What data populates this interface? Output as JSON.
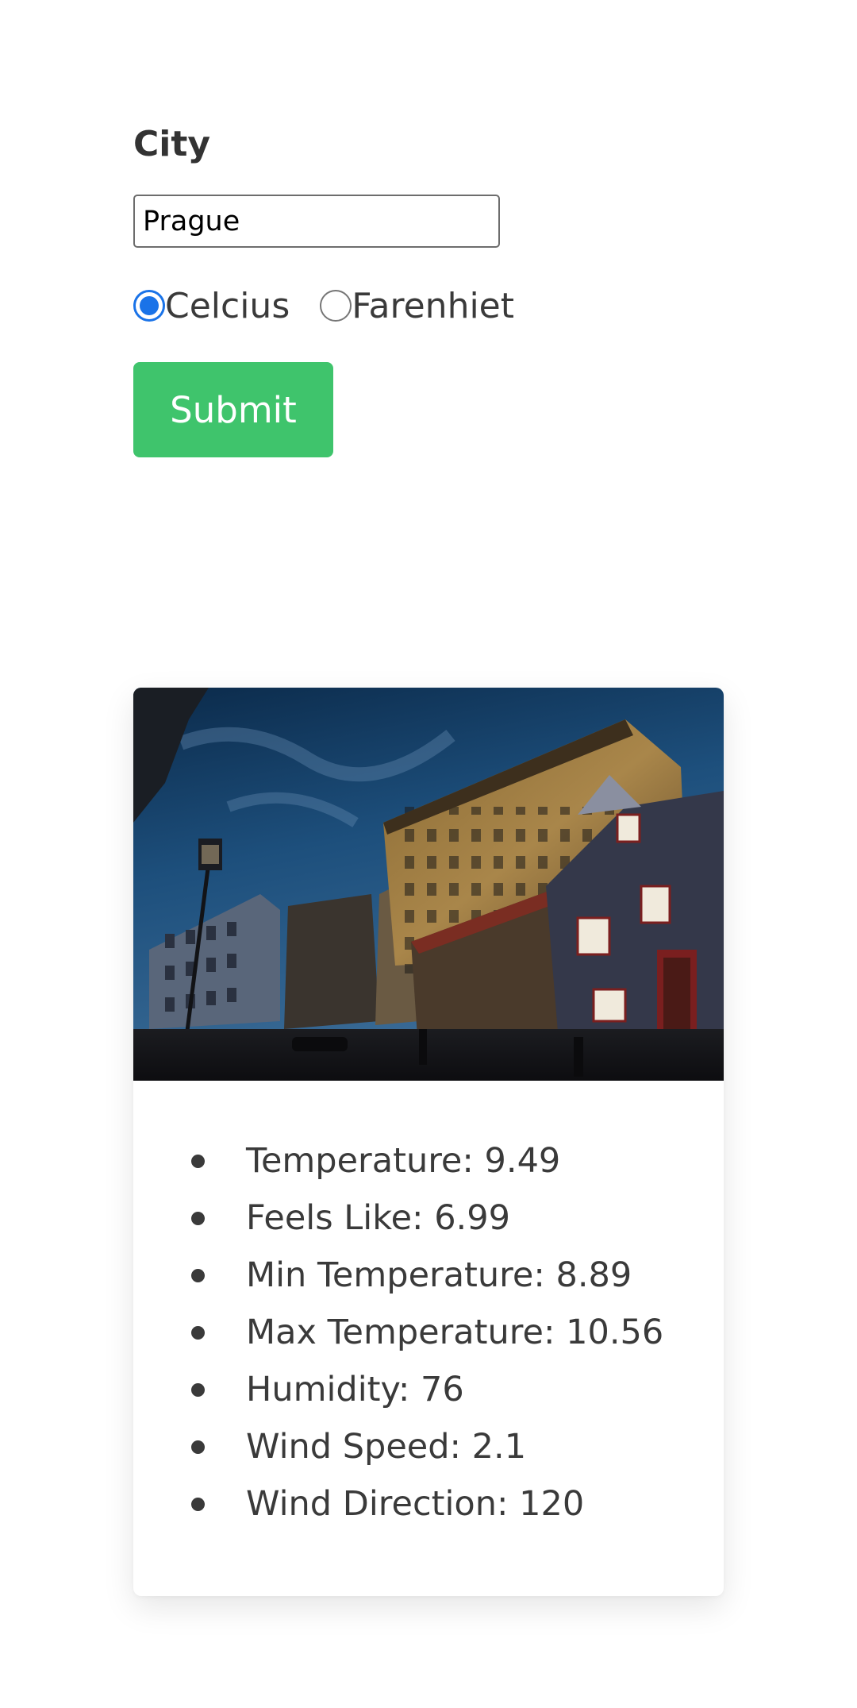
{
  "form": {
    "city_label": "City",
    "city_value": "Prague",
    "units": [
      {
        "label": "Celcius",
        "checked": true
      },
      {
        "label": "Farenhiet",
        "checked": false
      }
    ],
    "submit_label": "Submit"
  },
  "weather": {
    "photo_subject": "Prague street at dusk with sgraffito palace",
    "items": [
      {
        "text": "Temperature: 9.49"
      },
      {
        "text": "Feels Like: 6.99"
      },
      {
        "text": "Min Temperature: 8.89"
      },
      {
        "text": "Max Temperature: 10.56"
      },
      {
        "text": "Humidity: 76"
      },
      {
        "text": "Wind Speed: 2.1"
      },
      {
        "text": "Wind Direction: 120"
      }
    ]
  },
  "colors": {
    "accent_button": "#3fc46c",
    "radio_checked": "#1a73e8",
    "text": "#3a3a3a"
  }
}
